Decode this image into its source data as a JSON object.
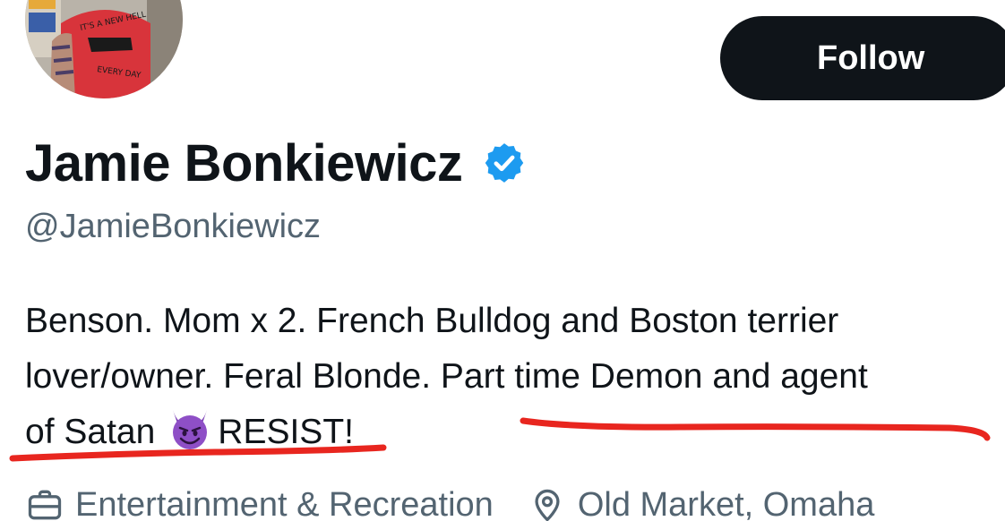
{
  "profile": {
    "display_name": "Jamie Bonkiewicz",
    "handle": "@JamieBonkiewicz",
    "verified": true,
    "avatar_shirt_text_top": "IT'S A NEW HELL",
    "avatar_shirt_text_bottom": "EVERY DAY"
  },
  "actions": {
    "follow_label": "Follow"
  },
  "bio": {
    "line1": "Benson. Mom x 2. French Bulldog and Boston terrier",
    "line2": "lover/owner. Feral Blonde. Part time Demon and agent",
    "line3_before_emoji": "of Satan",
    "line3_after_emoji": "RESIST!",
    "emoji": "smiling-face-with-horns"
  },
  "meta": {
    "category_icon": "briefcase-icon",
    "category": "Entertainment & Recreation",
    "location_icon": "location-pin-icon",
    "location": "Old Market, Omaha"
  },
  "colors": {
    "text_primary": "#0f1419",
    "text_secondary": "#536471",
    "follow_bg": "#0f1419",
    "follow_text": "#ffffff",
    "verified_blue": "#1d9bf0",
    "annotation_red": "#e8261f",
    "emoji_purple": "#7b3fb5"
  }
}
